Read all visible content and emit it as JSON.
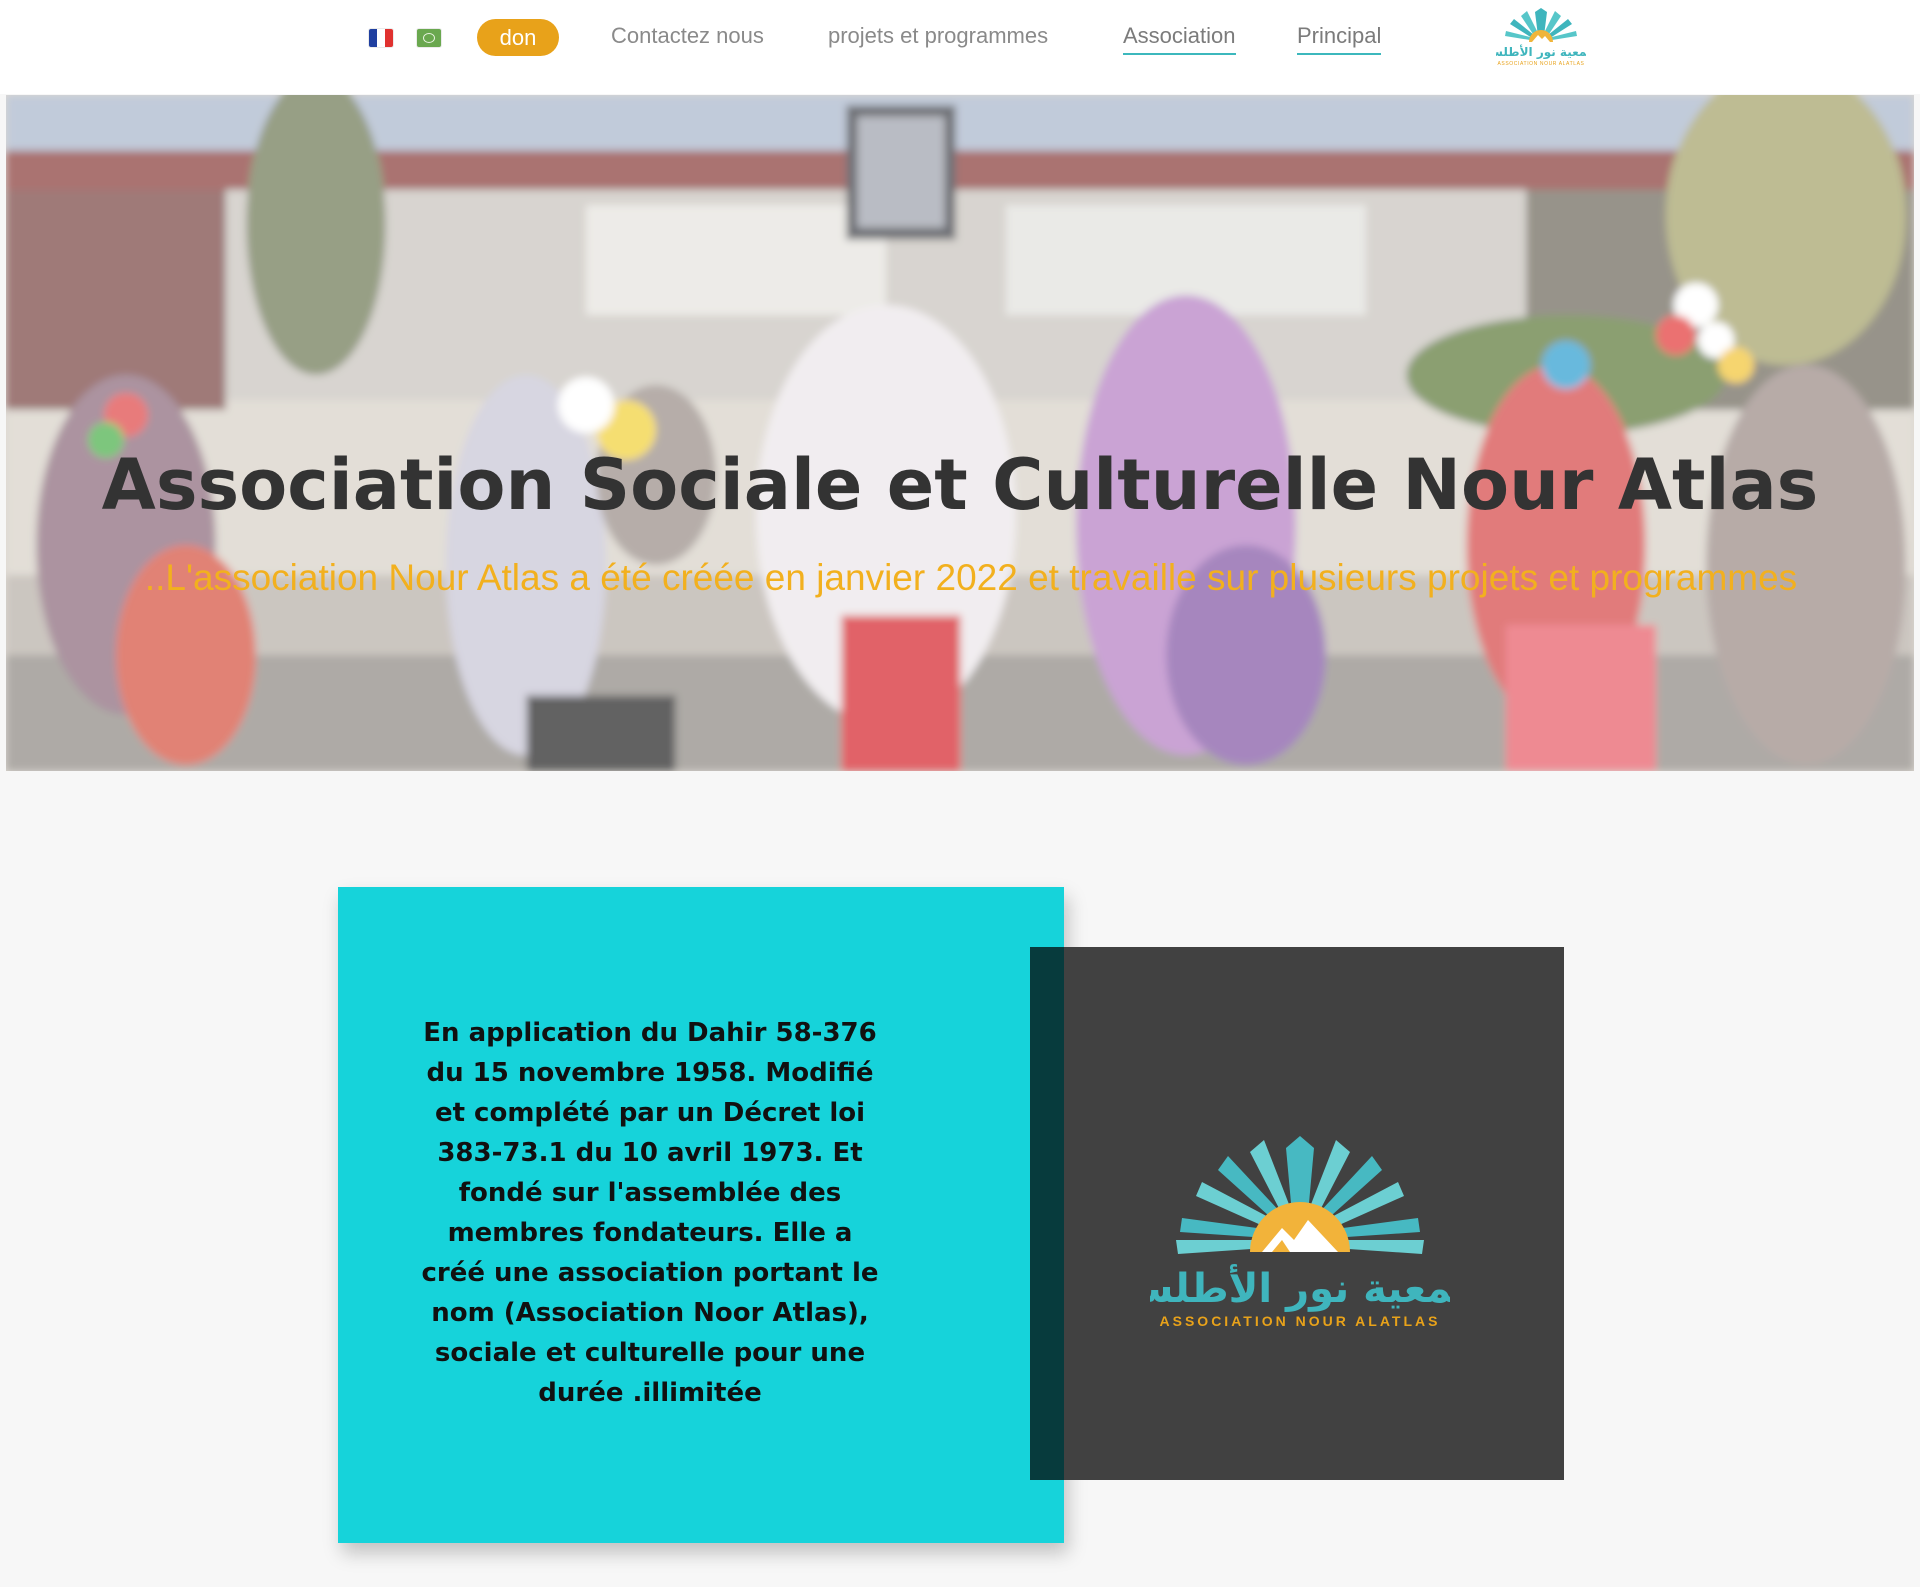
{
  "header": {
    "flags": [
      "fr-flag",
      "arabic-flag"
    ],
    "donate_label": "don",
    "nav": {
      "contact": "Contactez nous",
      "projects": "projets et programmes",
      "association": "Association",
      "home": "Principal"
    },
    "logo": {
      "arabic": "جمعية نور الأطلس",
      "latin": "ASSOCIATION NOUR ALATLAS"
    }
  },
  "hero": {
    "title": "Association Sociale et Culturelle Nour Atlas",
    "subtitle": "..L'association Nour Atlas a été créée en janvier 2022 et travaille sur plusieurs projets et programmes"
  },
  "about": {
    "text": "En application du Dahir 58-376 du 15 novembre 1958. Modifié et complété par un Décret loi 383-73.1 du 10 avril 1973. Et fondé sur l'assemblée des membres fondateurs. Elle a créé une association portant le nom (Association Noor Atlas), sociale et culturelle pour une durée .illimitée"
  },
  "logo_card": {
    "arabic": "جمعية نور الأطلس",
    "latin": "ASSOCIATION NOUR ALATLAS"
  },
  "colors": {
    "accent_orange": "#e8a21a",
    "teal": "#16d3da",
    "dark_gray": "#414141",
    "subtitle_gold": "#f2b01e"
  }
}
